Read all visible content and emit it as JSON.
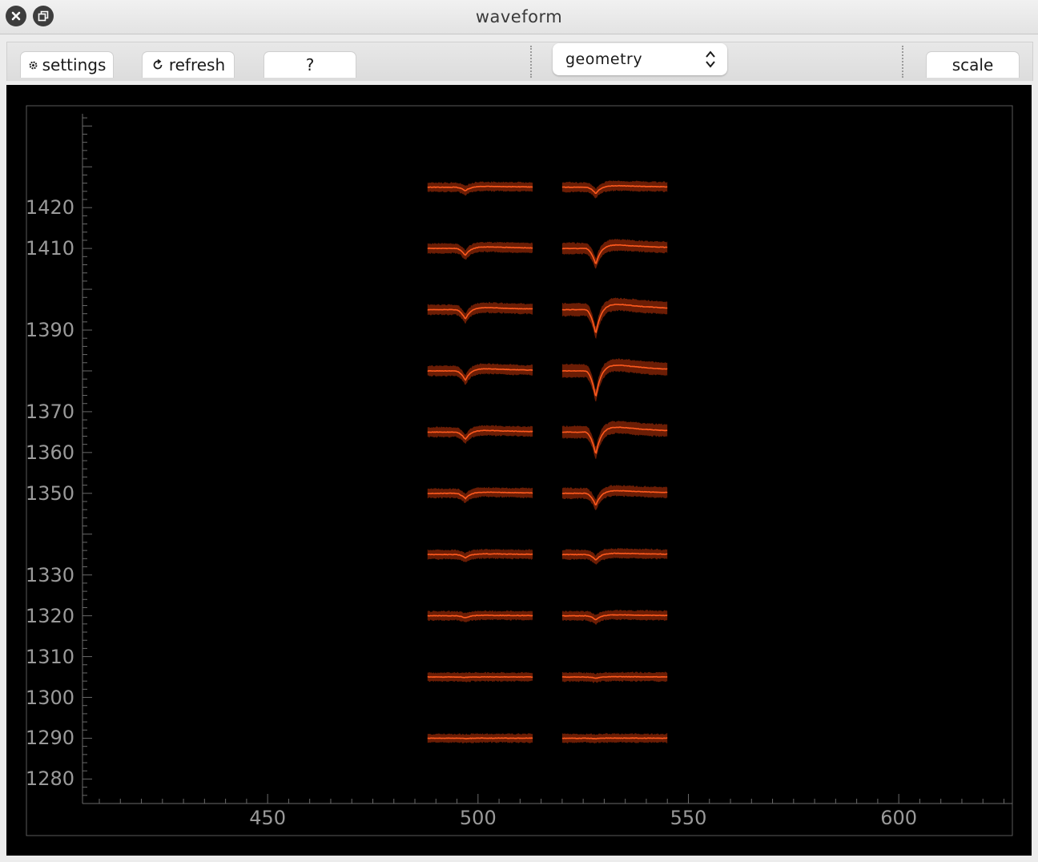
{
  "window": {
    "title": "waveform",
    "close_icon": "close-icon",
    "restore_icon": "restore-icon"
  },
  "toolbar": {
    "settings_label": "settings",
    "settings_icon": "gear-icon",
    "refresh_label": "refresh",
    "refresh_icon": "refresh-icon",
    "help_label": "?",
    "view_select_value": "geometry",
    "scale_label": "scale"
  },
  "chart_data": {
    "type": "line",
    "title": "",
    "xlabel": "",
    "ylabel": "",
    "xlim": [
      406,
      627
    ],
    "ylim": [
      1274,
      1443
    ],
    "x_ticks": [
      450,
      500,
      550,
      600
    ],
    "y_ticks": [
      1280,
      1290,
      1300,
      1310,
      1320,
      1330,
      1350,
      1360,
      1370,
      1390,
      1410,
      1420
    ],
    "grid": false,
    "legend": "none",
    "colors": {
      "mean_line": "#ff5a1e",
      "band": "#6b1d05",
      "background": "#000000",
      "tick_text": "#9a9a9a"
    },
    "columns": [
      {
        "x_start": 488,
        "x_end": 513,
        "trough_x": 497
      },
      {
        "x_start": 520,
        "x_end": 545,
        "trough_x": 528
      }
    ],
    "channels": [
      {
        "y": 1290,
        "amplitudes": [
          0.1,
          0.1
        ]
      },
      {
        "y": 1305,
        "amplitudes": [
          0.1,
          0.3
        ]
      },
      {
        "y": 1320,
        "amplitudes": [
          0.5,
          1.0
        ]
      },
      {
        "y": 1335,
        "amplitudes": [
          0.8,
          1.4
        ]
      },
      {
        "y": 1350,
        "amplitudes": [
          1.3,
          3.0
        ]
      },
      {
        "y": 1365,
        "amplitudes": [
          1.8,
          5.5
        ]
      },
      {
        "y": 1380,
        "amplitudes": [
          2.3,
          6.5
        ]
      },
      {
        "y": 1395,
        "amplitudes": [
          2.3,
          6.0
        ]
      },
      {
        "y": 1410,
        "amplitudes": [
          1.7,
          3.9
        ]
      },
      {
        "y": 1425,
        "amplitudes": [
          0.9,
          1.6
        ]
      }
    ]
  }
}
